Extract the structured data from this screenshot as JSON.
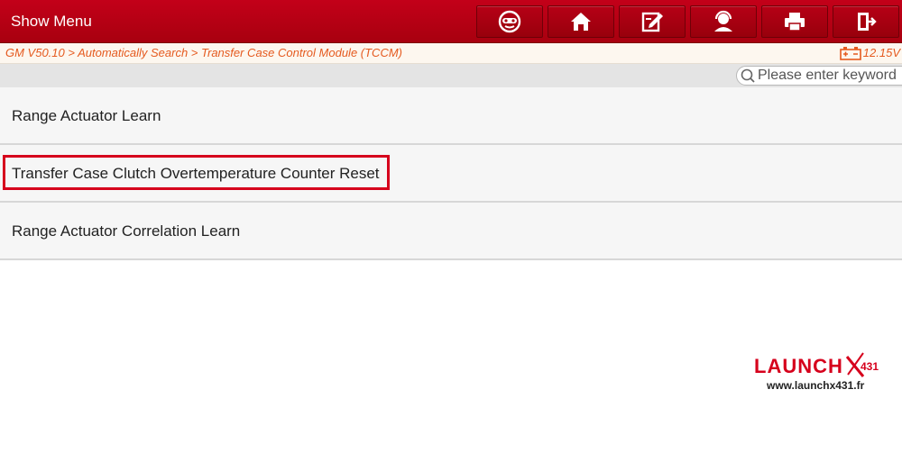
{
  "header": {
    "title": "Show Menu",
    "toolbar": [
      {
        "icon": "diagnostic-face-icon",
        "label": "Diagnose"
      },
      {
        "icon": "home-icon",
        "label": "Home"
      },
      {
        "icon": "edit-report-icon",
        "label": "Report"
      },
      {
        "icon": "user-support-icon",
        "label": "Support"
      },
      {
        "icon": "printer-icon",
        "label": "Print"
      },
      {
        "icon": "exit-icon",
        "label": "Exit"
      }
    ]
  },
  "breadcrumb": "GM V50.10 > Automatically Search > Transfer Case Control Module (TCCM)",
  "battery_voltage": "12.15V",
  "search": {
    "placeholder": "Please enter keyword"
  },
  "menu": {
    "items": [
      {
        "label": "Range Actuator Learn",
        "selected": false
      },
      {
        "label": "Transfer Case Clutch Overtemperature Counter Reset",
        "selected": true
      },
      {
        "label": "Range Actuator Correlation Learn",
        "selected": false
      }
    ]
  },
  "watermark": {
    "brand": "LAUNCH",
    "model": "431",
    "url": "www.launchx431.fr"
  },
  "colors": {
    "header": "#b3000f",
    "accent": "#d6001c",
    "breadcrumb": "#e55a1f"
  }
}
